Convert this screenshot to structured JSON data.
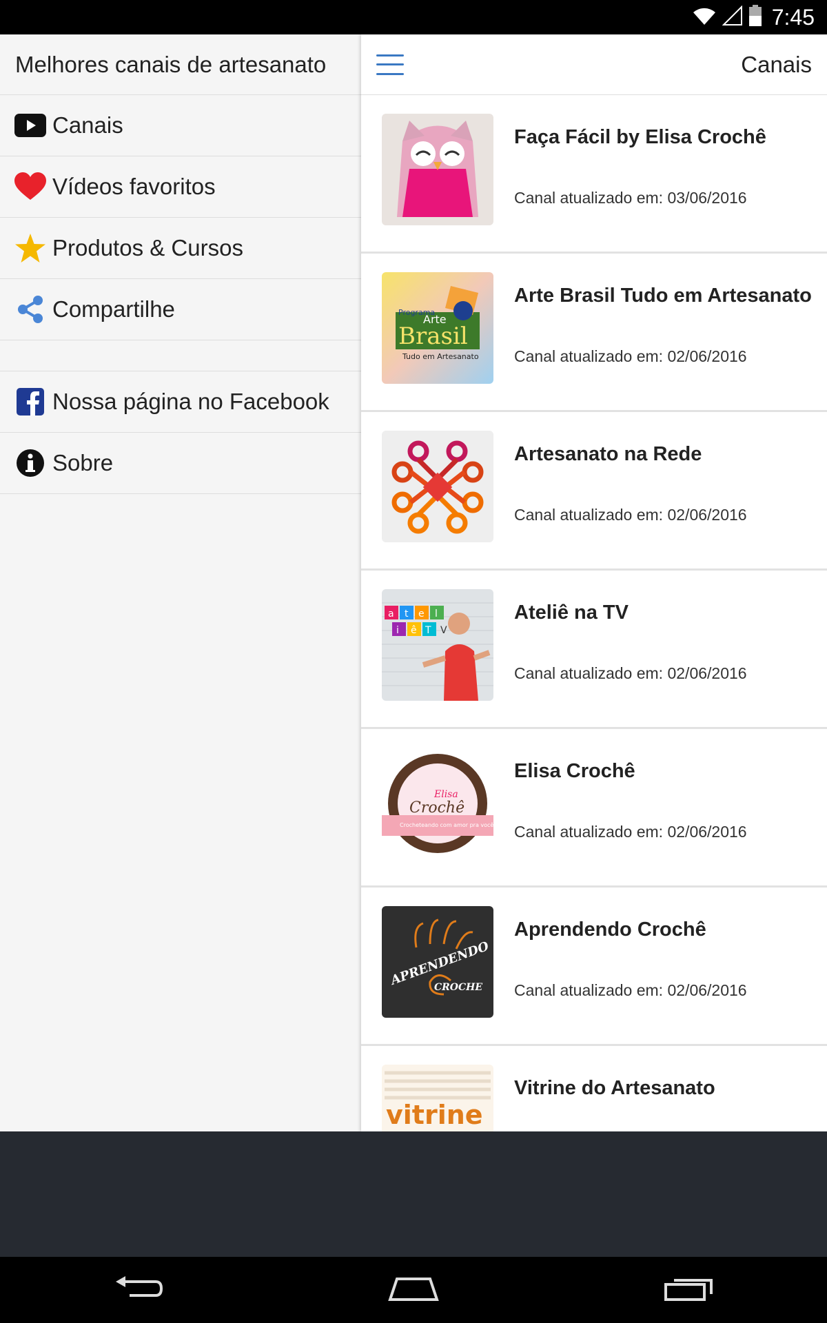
{
  "status_bar": {
    "time": "7:45"
  },
  "drawer": {
    "title": "Melhores canais de artesanato",
    "items": [
      {
        "label": "Canais",
        "icon": "youtube-play-icon"
      },
      {
        "label": "Vídeos favoritos",
        "icon": "heart-icon"
      },
      {
        "label": "Produtos & Cursos",
        "icon": "star-icon"
      },
      {
        "label": "Compartilhe",
        "icon": "share-icon"
      }
    ],
    "secondary_items": [
      {
        "label": "Nossa página no Facebook",
        "icon": "facebook-icon"
      },
      {
        "label": "Sobre",
        "icon": "info-icon"
      }
    ]
  },
  "main": {
    "title": "Canais",
    "channels": [
      {
        "title": "Faça Fácil by Elisa Crochê",
        "subtitle": "Canal atualizado em: 03/06/2016"
      },
      {
        "title": "Arte Brasil Tudo em Artesanato",
        "subtitle": "Canal atualizado em: 02/06/2016",
        "thumb_text": {
          "top": "Programa",
          "mid": "Arte",
          "brand": "Brasil",
          "bottom": "Tudo em Artesanato"
        }
      },
      {
        "title": "Artesanato na Rede",
        "subtitle": "Canal atualizado em: 02/06/2016"
      },
      {
        "title": "Ateliê na TV",
        "subtitle": "Canal atualizado em: 02/06/2016",
        "thumb_text": {
          "letters": [
            "a",
            "t",
            "e",
            "l",
            "i",
            "ê",
            "T",
            "V"
          ]
        }
      },
      {
        "title": "Elisa Crochê",
        "subtitle": "Canal atualizado em: 02/06/2016",
        "thumb_text": {
          "name": "Elisa",
          "word": "Crochê",
          "tagline": "Crocheteando com amor pra você!"
        }
      },
      {
        "title": "Aprendendo Crochê",
        "subtitle": "Canal atualizado em: 02/06/2016",
        "thumb_text": {
          "top": "APRENDENDO",
          "bottom": "CROCHE"
        }
      },
      {
        "title": "Vitrine do Artesanato",
        "subtitle": "",
        "thumb_text": {
          "word": "vitrine"
        }
      }
    ]
  },
  "colors": {
    "accent": "#3a78c3",
    "heart": "#e8222b",
    "star": "#f5b800",
    "facebook": "#1f3a93",
    "dark_band": "#262a31"
  }
}
